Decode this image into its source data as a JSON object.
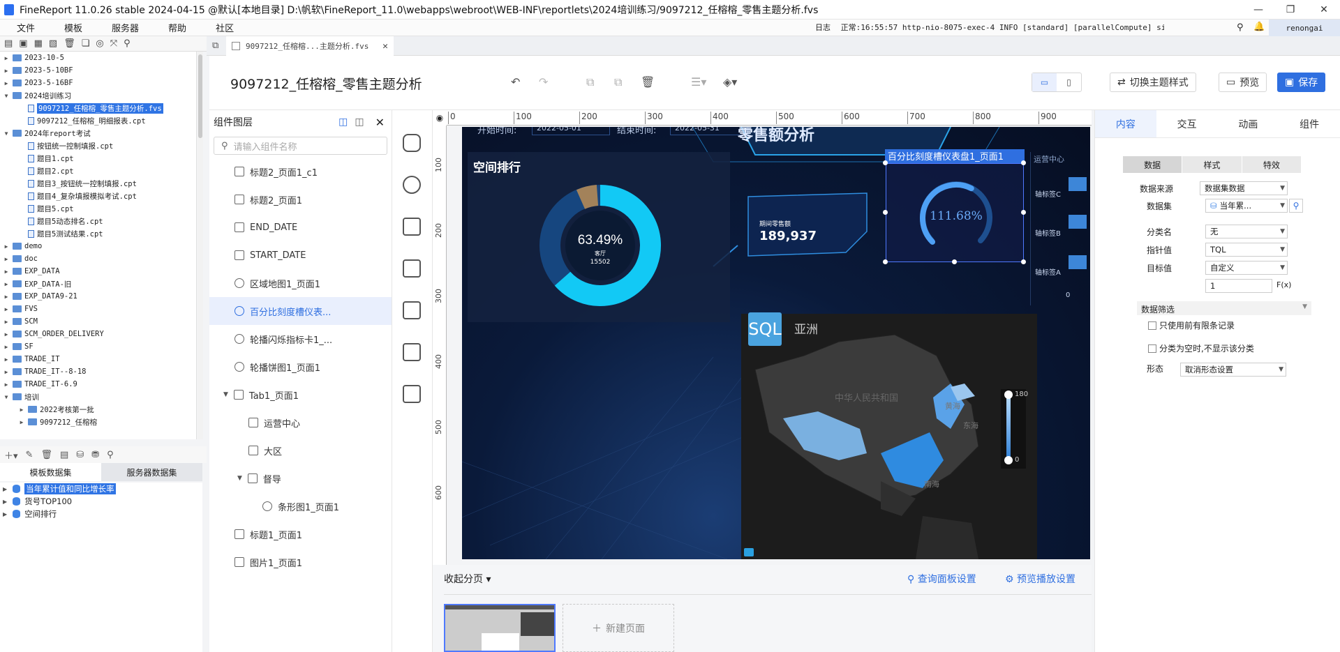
{
  "window": {
    "title": "FineReport 11.0.26 stable 2024-04-15 @默认[本地目录]   D:\\帆软\\FineReport_11.0\\webapps\\webroot\\WEB-INF\\reportlets\\2024培训练习/9097212_任榕榕_零售主题分析.fvs"
  },
  "menu": [
    "文件",
    "模板",
    "服务器",
    "帮助",
    "社区"
  ],
  "status": {
    "log_label": "日志",
    "log_text": "正常:16:55:57 http-nio-8075-exec-4 INFO [standard] [parallelCompute] single compute task s...",
    "user": "renongai"
  },
  "tree": [
    {
      "label": "2023-10-5",
      "level": 0,
      "type": "folder"
    },
    {
      "label": "2023-5-10BF",
      "level": 0,
      "type": "folder"
    },
    {
      "label": "2023-5-16BF",
      "level": 0,
      "type": "folder"
    },
    {
      "label": "2024培训练习",
      "level": 0,
      "type": "folder",
      "open": true
    },
    {
      "label": "9097212_任榕榕_零售主题分析.fvs",
      "level": 1,
      "type": "file",
      "selected": true
    },
    {
      "label": "9097212_任榕榕_明细报表.cpt",
      "level": 1,
      "type": "file"
    },
    {
      "label": "2024年report考试",
      "level": 0,
      "type": "folder",
      "open": true
    },
    {
      "label": "按钮统一控制填报.cpt",
      "level": 1,
      "type": "file"
    },
    {
      "label": "题目1.cpt",
      "level": 1,
      "type": "file"
    },
    {
      "label": "题目2.cpt",
      "level": 1,
      "type": "file"
    },
    {
      "label": "题目3_按钮统一控制填报.cpt",
      "level": 1,
      "type": "file"
    },
    {
      "label": "题目4_复杂填报模拟考试.cpt",
      "level": 1,
      "type": "file"
    },
    {
      "label": "题目5.cpt",
      "level": 1,
      "type": "file"
    },
    {
      "label": "题目5动态排名.cpt",
      "level": 1,
      "type": "file"
    },
    {
      "label": "题目5测试结果.cpt",
      "level": 1,
      "type": "file"
    },
    {
      "label": "demo",
      "level": 0,
      "type": "folder"
    },
    {
      "label": "doc",
      "level": 0,
      "type": "folder"
    },
    {
      "label": "EXP_DATA",
      "level": 0,
      "type": "folder"
    },
    {
      "label": "EXP_DATA-旧",
      "level": 0,
      "type": "folder"
    },
    {
      "label": "EXP_DATA9-21",
      "level": 0,
      "type": "folder"
    },
    {
      "label": "FVS",
      "level": 0,
      "type": "folder"
    },
    {
      "label": "SCM",
      "level": 0,
      "type": "folder"
    },
    {
      "label": "SCM_ORDER_DELIVERY",
      "level": 0,
      "type": "folder"
    },
    {
      "label": "SF",
      "level": 0,
      "type": "folder"
    },
    {
      "label": "TRADE_IT",
      "level": 0,
      "type": "folder"
    },
    {
      "label": "TRADE_IT--8-18",
      "level": 0,
      "type": "folder"
    },
    {
      "label": "TRADE_IT-6.9",
      "level": 0,
      "type": "folder"
    },
    {
      "label": "培训",
      "level": 0,
      "type": "folder",
      "open": true
    },
    {
      "label": "2022考核第一批",
      "level": 1,
      "type": "folder"
    },
    {
      "label": "9097212_任榕榕",
      "level": 1,
      "type": "folder"
    }
  ],
  "ds_tabs": [
    "模板数据集",
    "服务器数据集"
  ],
  "datasets": [
    {
      "label": "当年累计值和同比增长率",
      "selected": true
    },
    {
      "label": "货号TOP100"
    },
    {
      "label": "空间排行"
    }
  ],
  "doc_tab": "9097212_任榕榕...主题分析.fvs",
  "doc_title": "9097212_任榕榕_零售主题分析",
  "toolbar": {
    "switch_theme": "切换主题样式",
    "preview": "预览",
    "save": "保存"
  },
  "layer": {
    "title": "组件图层",
    "search_placeholder": "请输入组件名称",
    "items": [
      {
        "label": "标题2_页面1_c1",
        "icon": "text",
        "indent": 0
      },
      {
        "label": "标题2_页面1",
        "icon": "text",
        "indent": 0
      },
      {
        "label": "END_DATE",
        "icon": "date",
        "indent": 0
      },
      {
        "label": "START_DATE",
        "icon": "date",
        "indent": 0
      },
      {
        "label": "区域地图1_页面1",
        "icon": "chart",
        "indent": 0
      },
      {
        "label": "百分比刻度槽仪表...",
        "icon": "chart",
        "indent": 0,
        "selected": true
      },
      {
        "label": "轮播闪烁指标卡1_...",
        "icon": "chart",
        "indent": 0
      },
      {
        "label": "轮播饼图1_页面1",
        "icon": "chart",
        "indent": 0
      },
      {
        "label": "Tab1_页面1",
        "icon": "tab",
        "indent": 0,
        "toggle": true
      },
      {
        "label": "运营中心",
        "icon": "folder",
        "indent": 1
      },
      {
        "label": "大区",
        "icon": "folder",
        "indent": 1
      },
      {
        "label": "督导",
        "icon": "folder",
        "indent": 1,
        "toggle": true
      },
      {
        "label": "条形图1_页面1",
        "icon": "chart",
        "indent": 2
      },
      {
        "label": "标题1_页面1",
        "icon": "text",
        "indent": 0
      },
      {
        "label": "图片1_页面1",
        "icon": "image",
        "indent": 0
      }
    ]
  },
  "ruler_x": [
    "0",
    "100",
    "200",
    "300",
    "400",
    "500",
    "600",
    "700",
    "800",
    "900"
  ],
  "ruler_y": [
    "100",
    "200",
    "300",
    "400",
    "500",
    "600"
  ],
  "canvas": {
    "header_title": "零售额分析",
    "start_label": "开始时间:",
    "start_value": "2022-05-01",
    "end_label": "结束时间:",
    "end_value": "2022-05-31",
    "rank_title": "空间排行",
    "donut": {
      "percent": "63.49%",
      "label": "客厅",
      "value": "15502",
      "fraction": 0.6349
    },
    "kpi_label": "期间零售额",
    "kpi_value": "189,937",
    "gauge_selected_label": "百分比刻度槽仪表盘1_页面1",
    "gauge_value": "111.68%",
    "gauge_fraction": 0.6,
    "ops_tab": "运营中心",
    "axis_labels": [
      "轴标签C",
      "轴标签B",
      "轴标签A"
    ],
    "axis_zero": "0",
    "map_badge": "SQL",
    "map_title": "亚洲",
    "map_labels": {
      "country": "中华人民共和国",
      "sea1": "黄海",
      "sea2": "东海",
      "sea3": "南海"
    },
    "legend_max": "180",
    "legend_min": "0"
  },
  "pager": {
    "collapse": "收起分页",
    "query_settings": "查询面板设置",
    "preview_settings": "预览播放设置",
    "new_page": "新建页面"
  },
  "props": {
    "tabs": [
      "内容",
      "交互",
      "动画",
      "组件"
    ],
    "subtabs": [
      "数据",
      "样式",
      "特效"
    ],
    "rows": [
      {
        "label": "数据来源",
        "value": "数据集数据"
      },
      {
        "label": "数据集",
        "value": "当年累..."
      },
      {
        "label": "分类名",
        "value": "无"
      },
      {
        "label": "指针值",
        "value": "TQL"
      },
      {
        "label": "目标值",
        "value": "自定义"
      }
    ],
    "target_input": "1",
    "fx": "F(x)",
    "filter_title": "数据筛选",
    "check1": "只使用前有限条记录",
    "check2": "分类为空时,不显示该分类",
    "shape_label": "形态",
    "shape_value": "取消形态设置"
  }
}
